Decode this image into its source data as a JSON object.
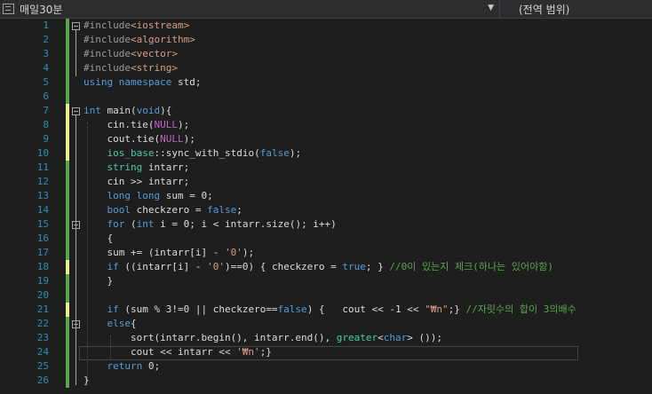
{
  "toolbar": {
    "scope_label": "매일30분",
    "member_label": "(전역 범위)"
  },
  "colors": {
    "background": "#1e1e1e",
    "line_number": "#2b91af",
    "keyword": "#569cd6",
    "string": "#d69d85",
    "comment": "#57a64a",
    "macro": "#bd63c5",
    "type": "#4ec9b0",
    "change_saved": "#57a64a",
    "change_unsaved": "#efef91"
  },
  "lines": [
    {
      "n": "1",
      "mark": "g",
      "fold": "open",
      "tokens": [
        {
          "t": "#include",
          "c": "pp"
        },
        {
          "t": "<iostream>",
          "c": "inc"
        }
      ]
    },
    {
      "n": "2",
      "mark": "g",
      "tokens": [
        {
          "t": "#include",
          "c": "pp"
        },
        {
          "t": "<algorithm>",
          "c": "inc"
        }
      ]
    },
    {
      "n": "3",
      "mark": "g",
      "tokens": [
        {
          "t": "#include",
          "c": "pp"
        },
        {
          "t": "<vector>",
          "c": "inc"
        }
      ]
    },
    {
      "n": "4",
      "mark": "g",
      "tokens": [
        {
          "t": "#include",
          "c": "pp"
        },
        {
          "t": "<string>",
          "c": "inc"
        }
      ]
    },
    {
      "n": "5",
      "mark": "g",
      "tokens": [
        {
          "t": "using",
          "c": "kw"
        },
        {
          "t": " ",
          "c": "pl"
        },
        {
          "t": "namespace",
          "c": "kw"
        },
        {
          "t": " std;",
          "c": "pl"
        }
      ]
    },
    {
      "n": "6",
      "mark": "g",
      "tokens": []
    },
    {
      "n": "7",
      "mark": "y",
      "fold": "open",
      "tokens": [
        {
          "t": "int",
          "c": "kw"
        },
        {
          "t": " main(",
          "c": "pl"
        },
        {
          "t": "void",
          "c": "kw"
        },
        {
          "t": "){",
          "c": "pl"
        }
      ]
    },
    {
      "n": "8",
      "mark": "y",
      "tokens": [
        {
          "t": "    cin.tie(",
          "c": "pl"
        },
        {
          "t": "NULL",
          "c": "mac"
        },
        {
          "t": ");",
          "c": "pl"
        }
      ]
    },
    {
      "n": "9",
      "mark": "y",
      "tokens": [
        {
          "t": "    cout.tie(",
          "c": "pl"
        },
        {
          "t": "NULL",
          "c": "mac"
        },
        {
          "t": ");",
          "c": "pl"
        }
      ]
    },
    {
      "n": "10",
      "mark": "y",
      "tokens": [
        {
          "t": "    ",
          "c": "pl"
        },
        {
          "t": "ios_base",
          "c": "ty"
        },
        {
          "t": "::sync_with_stdio(",
          "c": "pl"
        },
        {
          "t": "false",
          "c": "kw"
        },
        {
          "t": ");",
          "c": "pl"
        }
      ]
    },
    {
      "n": "11",
      "mark": "g",
      "tokens": [
        {
          "t": "    ",
          "c": "pl"
        },
        {
          "t": "string",
          "c": "ty"
        },
        {
          "t": " intarr;",
          "c": "pl"
        }
      ]
    },
    {
      "n": "12",
      "mark": "g",
      "tokens": [
        {
          "t": "    cin >> intarr;",
          "c": "pl"
        }
      ]
    },
    {
      "n": "13",
      "mark": "g",
      "tokens": [
        {
          "t": "    ",
          "c": "pl"
        },
        {
          "t": "long long",
          "c": "kw"
        },
        {
          "t": " sum = 0;",
          "c": "pl"
        }
      ]
    },
    {
      "n": "14",
      "mark": "g",
      "tokens": [
        {
          "t": "    ",
          "c": "pl"
        },
        {
          "t": "bool",
          "c": "kw"
        },
        {
          "t": " checkzero = ",
          "c": "pl"
        },
        {
          "t": "false",
          "c": "kw"
        },
        {
          "t": ";",
          "c": "pl"
        }
      ]
    },
    {
      "n": "15",
      "mark": "g",
      "fold": "open",
      "tokens": [
        {
          "t": "    ",
          "c": "pl"
        },
        {
          "t": "for",
          "c": "kw"
        },
        {
          "t": " (",
          "c": "pl"
        },
        {
          "t": "int",
          "c": "kw"
        },
        {
          "t": " i = 0; i < intarr.size(); i++)",
          "c": "pl"
        }
      ]
    },
    {
      "n": "16",
      "mark": "g",
      "tokens": [
        {
          "t": "    {",
          "c": "pl"
        }
      ]
    },
    {
      "n": "17",
      "mark": "g",
      "tokens": [
        {
          "t": "    sum += (intarr[i] - ",
          "c": "pl"
        },
        {
          "t": "'0'",
          "c": "str"
        },
        {
          "t": ");",
          "c": "pl"
        }
      ]
    },
    {
      "n": "18",
      "mark": "y",
      "tokens": [
        {
          "t": "    ",
          "c": "pl"
        },
        {
          "t": "if",
          "c": "kw"
        },
        {
          "t": " ((intarr[i] - ",
          "c": "pl"
        },
        {
          "t": "'0'",
          "c": "str"
        },
        {
          "t": ")==0) { checkzero = ",
          "c": "pl"
        },
        {
          "t": "true",
          "c": "kw"
        },
        {
          "t": "; } ",
          "c": "pl"
        },
        {
          "t": "//0이 있는지 체크(하나는 있어야함)",
          "c": "cmt"
        }
      ]
    },
    {
      "n": "19",
      "mark": "g",
      "tokens": [
        {
          "t": "    }",
          "c": "pl"
        }
      ]
    },
    {
      "n": "20",
      "mark": "g",
      "tokens": []
    },
    {
      "n": "21",
      "mark": "y",
      "tokens": [
        {
          "t": "    ",
          "c": "pl"
        },
        {
          "t": "if",
          "c": "kw"
        },
        {
          "t": " (sum % 3!=0 || checkzero==",
          "c": "pl"
        },
        {
          "t": "false",
          "c": "kw"
        },
        {
          "t": ") {   cout << -1 << ",
          "c": "pl"
        },
        {
          "t": "\"₩n\"",
          "c": "str"
        },
        {
          "t": ";} ",
          "c": "pl"
        },
        {
          "t": "//자릿수의 합이 3의배수",
          "c": "cmt"
        }
      ]
    },
    {
      "n": "22",
      "mark": "g",
      "fold": "open",
      "tokens": [
        {
          "t": "    ",
          "c": "pl"
        },
        {
          "t": "else",
          "c": "kw"
        },
        {
          "t": "{",
          "c": "pl"
        }
      ]
    },
    {
      "n": "23",
      "mark": "g",
      "tokens": [
        {
          "t": "        sort(intarr.begin(), intarr.end(), ",
          "c": "pl"
        },
        {
          "t": "greater",
          "c": "ty"
        },
        {
          "t": "<",
          "c": "pl"
        },
        {
          "t": "char",
          "c": "kw"
        },
        {
          "t": "> ());",
          "c": "pl"
        }
      ]
    },
    {
      "n": "24",
      "mark": "g",
      "tokens": [
        {
          "t": "        cout << intarr << ",
          "c": "pl"
        },
        {
          "t": "'₩n'",
          "c": "str"
        },
        {
          "t": ";}",
          "c": "pl"
        }
      ]
    },
    {
      "n": "25",
      "mark": "g",
      "tokens": [
        {
          "t": "    ",
          "c": "pl"
        },
        {
          "t": "return",
          "c": "kw"
        },
        {
          "t": " 0;",
          "c": "pl"
        }
      ]
    },
    {
      "n": "26",
      "mark": "g",
      "tokens": [
        {
          "t": "}",
          "c": "pl"
        }
      ]
    }
  ]
}
